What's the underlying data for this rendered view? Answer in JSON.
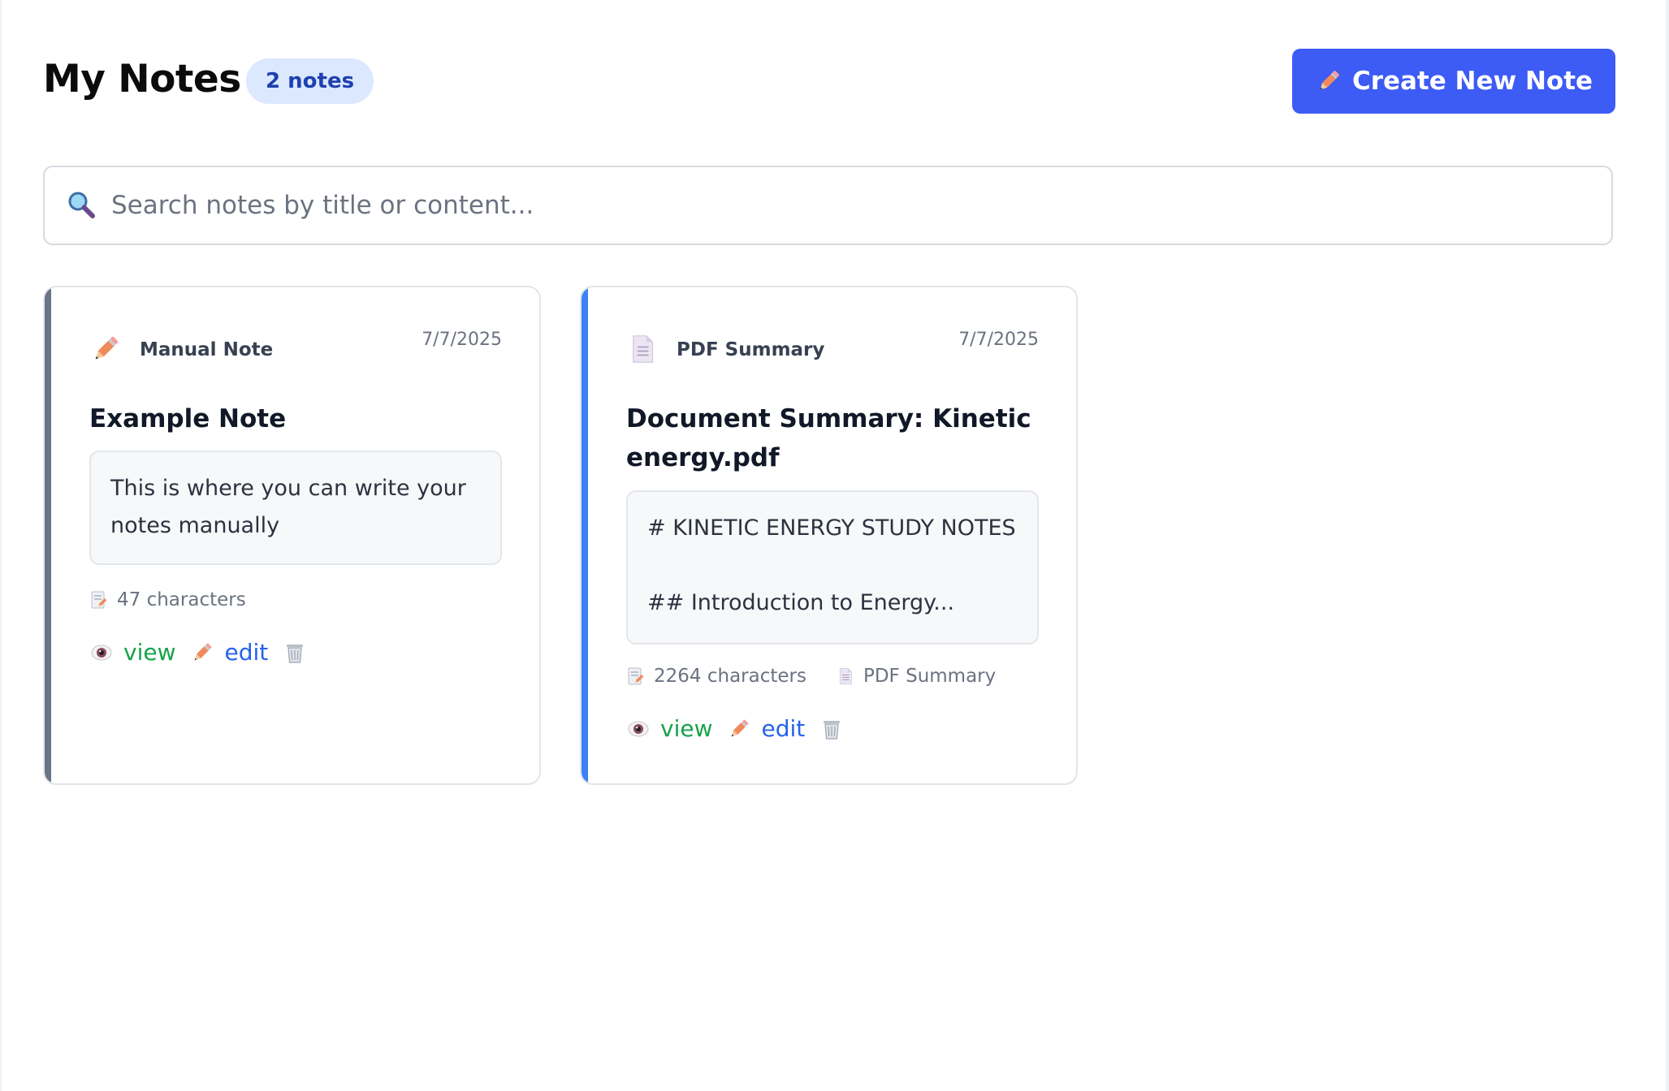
{
  "header": {
    "title": "My Notes",
    "count_badge": "2 notes",
    "create_button_label": "Create New Note",
    "create_button_icon": "pencil-icon",
    "accent_color": "#3d5bf5"
  },
  "search": {
    "placeholder": "Search notes by title or content...",
    "value": "",
    "icon": "magnifier-icon"
  },
  "notes": [
    {
      "type_label": "Manual Note",
      "type_icon": "pencil-icon",
      "date": "7/7/2025",
      "title": "Example Note",
      "content_preview": "This is where you can write your notes manually",
      "char_count": "47 characters",
      "accent_color": "#6b7486",
      "actions": {
        "view": "view",
        "edit": "edit"
      }
    },
    {
      "type_label": "PDF Summary",
      "type_icon": "document-icon",
      "date": "7/7/2025",
      "title": "Document Summary: Kinetic energy.pdf",
      "content_preview": "# KINETIC ENERGY STUDY NOTES\n\n## Introduction to Energy...",
      "char_count": "2264 characters",
      "source_label": "PDF Summary",
      "accent_color": "#3b82f6",
      "actions": {
        "view": "view",
        "edit": "edit"
      }
    }
  ]
}
